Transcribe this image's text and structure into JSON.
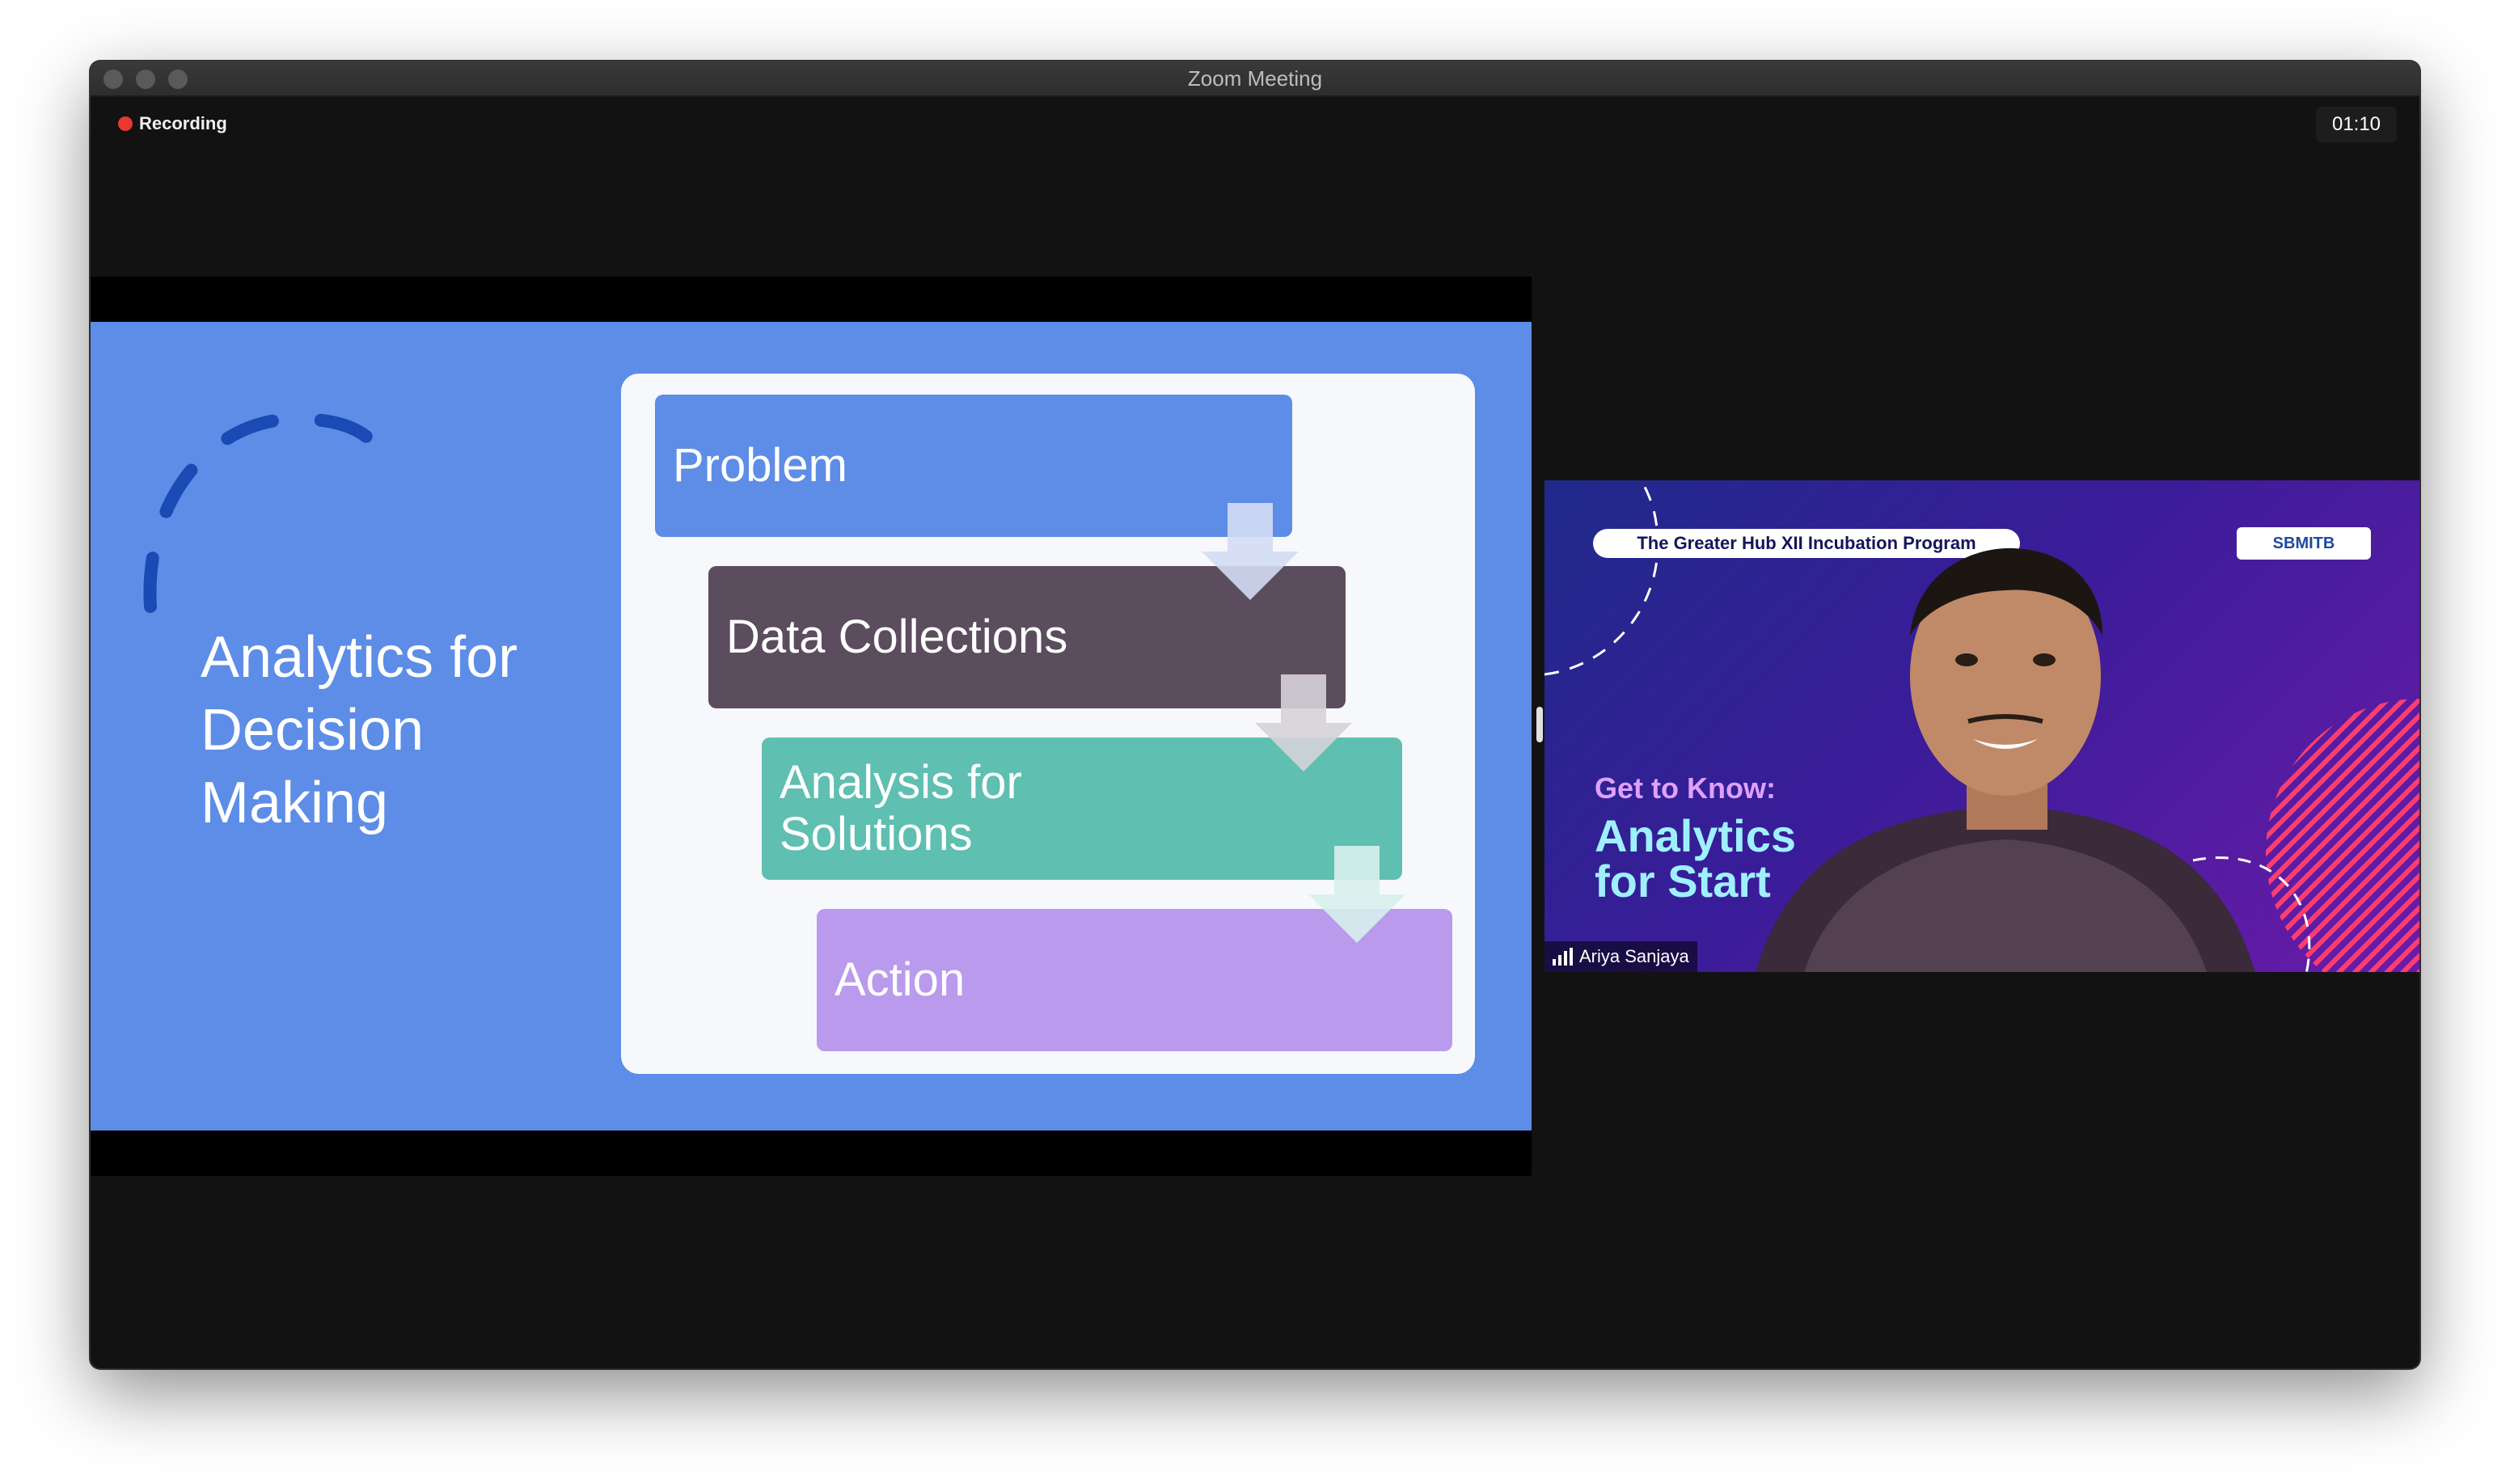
{
  "window": {
    "title": "Zoom Meeting"
  },
  "recording": {
    "label": "Recording"
  },
  "timer": {
    "value": "01:10"
  },
  "slide": {
    "title_lines": [
      "Analytics for",
      "Decision",
      "Making"
    ],
    "steps": [
      {
        "label_lines": [
          "Problem"
        ],
        "color": "#5d8de6"
      },
      {
        "label_lines": [
          "Data Collections"
        ],
        "color": "#5b4c5e"
      },
      {
        "label_lines": [
          "Analysis for",
          "Solutions"
        ],
        "color": "#5fbfb1"
      },
      {
        "label_lines": [
          "Action"
        ],
        "color": "#b99aec"
      }
    ]
  },
  "video": {
    "banner": "The Greater Hub XII Incubation Program",
    "logo": "SBMITB",
    "get_to_know": "Get to Know:",
    "title_lines": [
      "Analytics",
      "for Start"
    ],
    "participant": "Ariya Sanjaya"
  },
  "colors": {
    "slide_bg": "#5d8de6",
    "record_dot": "#e8382f"
  }
}
